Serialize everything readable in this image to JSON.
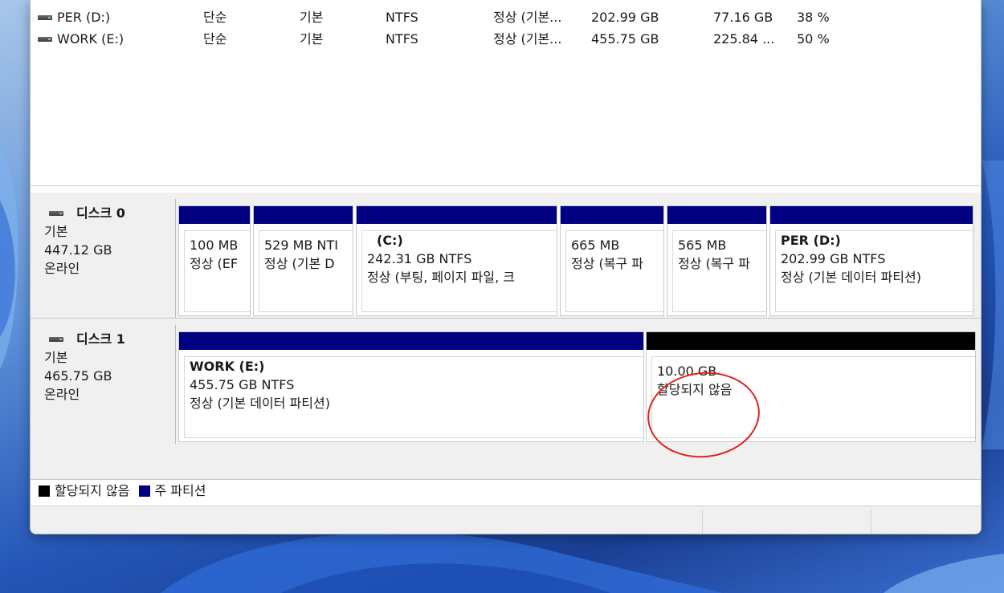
{
  "volumes": [
    {
      "name": "PER (D:)",
      "layout": "단순",
      "type": "기본",
      "fs": "NTFS",
      "status": "정상 (기본...",
      "capacity": "202.99 GB",
      "free": "77.16 GB",
      "pct": "38 %"
    },
    {
      "name": "WORK (E:)",
      "layout": "단순",
      "type": "기본",
      "fs": "NTFS",
      "status": "정상 (기본...",
      "capacity": "455.75 GB",
      "free": "225.84 ...",
      "pct": "50 %"
    }
  ],
  "disks": [
    {
      "title": "디스크 0",
      "type": "기본",
      "size": "447.12 GB",
      "state": "온라인",
      "partitions": [
        {
          "name": "",
          "size": "100 MB",
          "status": "정상 (EF",
          "bar": "primary"
        },
        {
          "name": "",
          "size": "529 MB NTI",
          "status": "정상 (기본 D",
          "bar": "primary"
        },
        {
          "name": "(C:)",
          "size": "242.31 GB NTFS",
          "status": "정상 (부팅, 페이지 파일, 크",
          "bar": "primary"
        },
        {
          "name": "",
          "size": "665 MB",
          "status": "정상 (복구 파",
          "bar": "primary"
        },
        {
          "name": "",
          "size": "565 MB",
          "status": "정상 (복구 파",
          "bar": "primary"
        },
        {
          "name": "PER  (D:)",
          "size": "202.99 GB NTFS",
          "status": "정상 (기본 데이터 파티션)",
          "bar": "primary"
        }
      ]
    },
    {
      "title": "디스크 1",
      "type": "기본",
      "size": "465.75 GB",
      "state": "온라인",
      "partitions": [
        {
          "name": "WORK  (E:)",
          "size": "455.75 GB NTFS",
          "status": "정상 (기본 데이터 파티션)",
          "bar": "primary"
        },
        {
          "name": "",
          "size": "10.00 GB",
          "status": "할당되지 않음",
          "bar": "unallocated"
        }
      ]
    }
  ],
  "legend": {
    "unallocated": "할당되지 않음",
    "primary": "주 파티션"
  },
  "colors": {
    "primary_bar": "#000080",
    "unallocated_bar": "#000000",
    "annotation": "#e02020"
  }
}
